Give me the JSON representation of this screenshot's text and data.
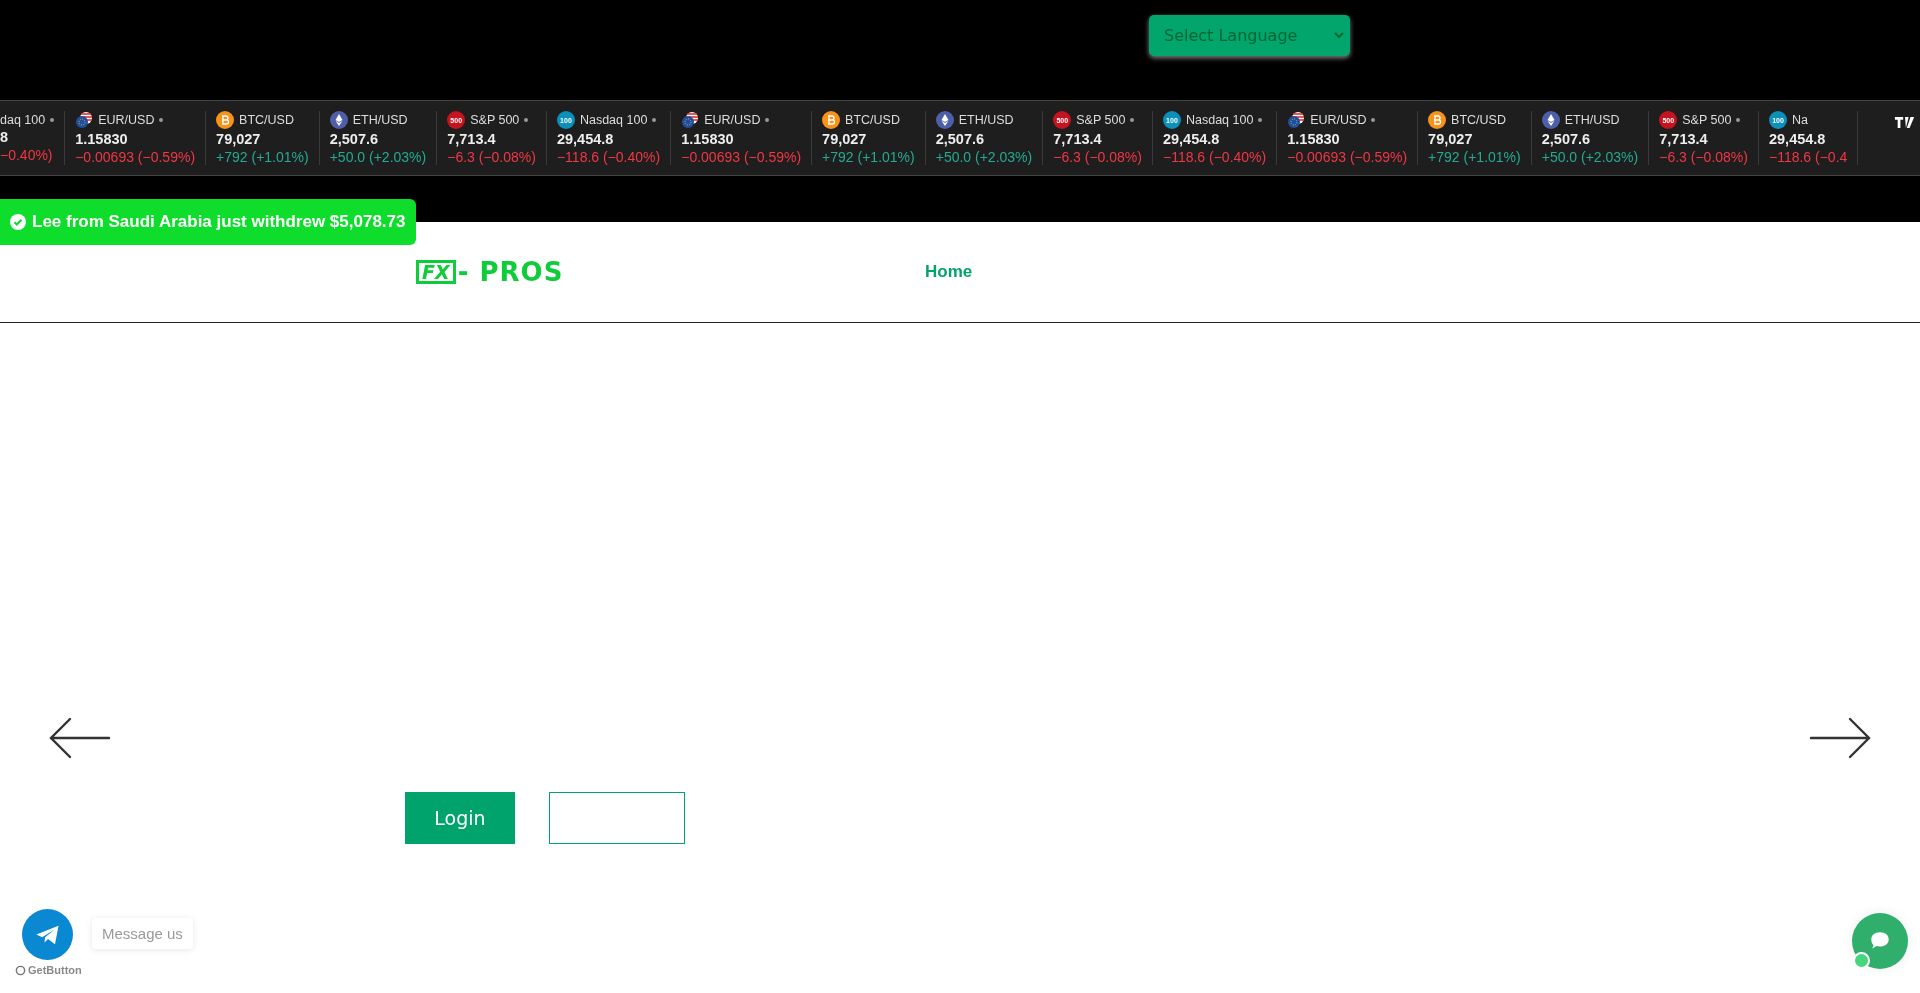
{
  "language_select": {
    "value": "Select Language"
  },
  "ticker": [
    {
      "kind": "index",
      "name": "daq 100",
      "dot": true,
      "price": "8",
      "change": "−0.40%)",
      "up": false
    },
    {
      "kind": "forex",
      "name": "EUR/USD",
      "dot": true,
      "price": "1.15830",
      "change": "−0.00693 (−0.59%)",
      "up": false
    },
    {
      "kind": "btc",
      "name": "BTC/USD",
      "dot": false,
      "price": "79,027",
      "change": "+792 (+1.01%)",
      "up": true
    },
    {
      "kind": "eth",
      "name": "ETH/USD",
      "dot": false,
      "price": "2,507.6",
      "change": "+50.0 (+2.03%)",
      "up": true
    },
    {
      "kind": "index",
      "badge": "500",
      "color": "#c4141f",
      "name": "S&P 500",
      "dot": true,
      "price": "7,713.4",
      "change": "−6.3 (−0.08%)",
      "up": false
    },
    {
      "kind": "index",
      "badge": "100",
      "color": "#0c8fb8",
      "name": "Nasdaq 100",
      "dot": true,
      "price": "29,454.8",
      "change": "−118.6 (−0.40%)",
      "up": false
    },
    {
      "kind": "forex",
      "name": "EUR/USD",
      "dot": true,
      "price": "1.15830",
      "change": "−0.00693 (−0.59%)",
      "up": false
    },
    {
      "kind": "btc",
      "name": "BTC/USD",
      "dot": false,
      "price": "79,027",
      "change": "+792 (+1.01%)",
      "up": true
    },
    {
      "kind": "eth",
      "name": "ETH/USD",
      "dot": false,
      "price": "2,507.6",
      "change": "+50.0 (+2.03%)",
      "up": true
    },
    {
      "kind": "index",
      "badge": "500",
      "color": "#c4141f",
      "name": "S&P 500",
      "dot": true,
      "price": "7,713.4",
      "change": "−6.3 (−0.08%)",
      "up": false
    },
    {
      "kind": "index",
      "badge": "100",
      "color": "#0c8fb8",
      "name": "Nasdaq 100",
      "dot": true,
      "price": "29,454.8",
      "change": "−118.6 (−0.40%)",
      "up": false
    },
    {
      "kind": "forex",
      "name": "EUR/USD",
      "dot": true,
      "price": "1.15830",
      "change": "−0.00693 (−0.59%)",
      "up": false
    },
    {
      "kind": "btc",
      "name": "BTC/USD",
      "dot": false,
      "price": "79,027",
      "change": "+792 (+1.01%)",
      "up": true
    },
    {
      "kind": "eth",
      "name": "ETH/USD",
      "dot": false,
      "price": "2,507.6",
      "change": "+50.0 (+2.03%)",
      "up": true
    },
    {
      "kind": "index",
      "badge": "500",
      "color": "#c4141f",
      "name": "S&P 500",
      "dot": true,
      "price": "7,713.4",
      "change": "−6.3 (−0.08%)",
      "up": false
    },
    {
      "kind": "index",
      "badge": "100",
      "color": "#0c8fb8",
      "name": "Na",
      "dot": false,
      "price": "29,454.8",
      "change": "−118.6 (−0.4",
      "up": false
    }
  ],
  "notification": {
    "text": "Lee from Saudi Arabia just withdrew $5,078.73"
  },
  "header": {
    "logo_mark": "FX",
    "logo_text": "- PROS",
    "nav": [
      {
        "label": "Home",
        "selected": true
      }
    ]
  },
  "hero": {
    "buttons": [
      {
        "label": "Login",
        "kind": "filled"
      },
      {
        "kind": "outline"
      }
    ]
  },
  "widget": {
    "message": "Message us",
    "credit": "GetButton"
  }
}
